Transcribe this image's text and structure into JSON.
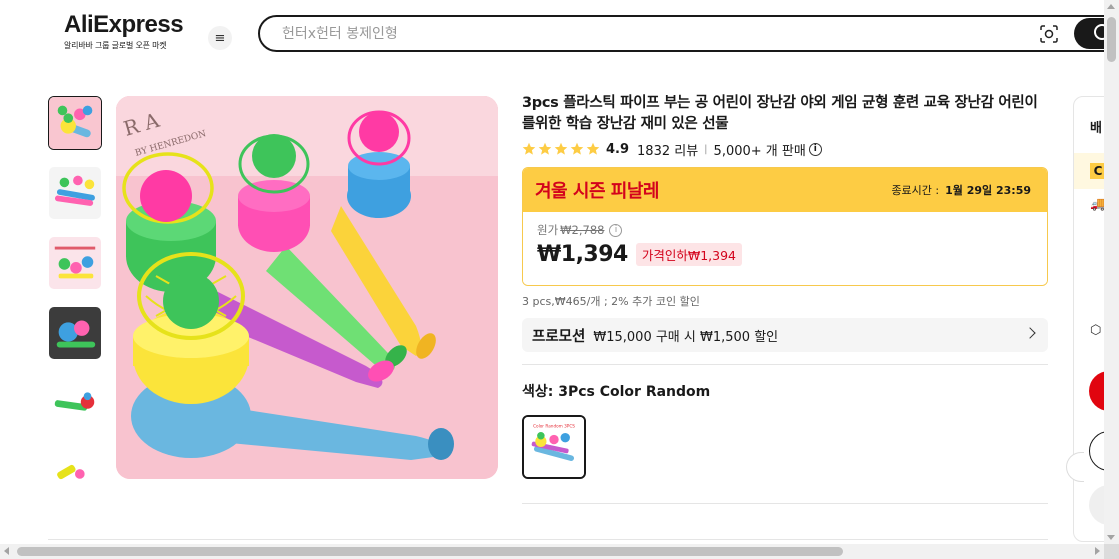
{
  "header": {
    "logo_text": "AliExpress",
    "logo_subtitle": "알리바바 그룹 글로벌 오픈 마켓",
    "search_placeholder": "헌터x헌터 봉제인형"
  },
  "thumbnails": [
    {
      "name": "thumb-1",
      "active": true
    },
    {
      "name": "thumb-2",
      "active": false
    },
    {
      "name": "thumb-3",
      "active": false
    },
    {
      "name": "thumb-4",
      "active": false
    },
    {
      "name": "thumb-5",
      "active": false
    },
    {
      "name": "thumb-6",
      "active": false
    }
  ],
  "product": {
    "title": "3pcs 플라스틱 파이프 부는 공 어린이 장난감 야외 게임 균형 훈련 교육 장난감 어린이를위한 학습 장난감 재미 있은 선물",
    "rating": "4.9",
    "star_count": 5,
    "reviews": "1832 리뷰",
    "sold": "5,000+ 개 판매",
    "promo_name": "겨울 시즌 피날레",
    "end_label": "종료시간 :",
    "end_time": "1월 29일 23:59",
    "original_label": "원가",
    "original_price": "₩2,788",
    "current_price": "₩1,394",
    "discount_badge": "가격인하₩1,394",
    "unit_note": "3 pcs,₩465/개 ; 2% 추가 코인 할인",
    "promotion_label": "프로모션",
    "promotion_text": "₩15,000 구매 시 ₩1,500 할인",
    "color_label": "색상: 3Pcs Color Random",
    "swatch_caption": "Color Random 3PCS"
  },
  "side_panel": {
    "shipping_label": "배",
    "band_icon": "C",
    "truck_icon": "🚚",
    "box_icon": "⬡"
  },
  "icons": {
    "menu": "≡",
    "info": "i"
  },
  "colors": {
    "accent_red": "#d3031c",
    "promo_yellow": "#fdcc44",
    "star": "#fdcc44",
    "buy_red": "#e1050f"
  }
}
